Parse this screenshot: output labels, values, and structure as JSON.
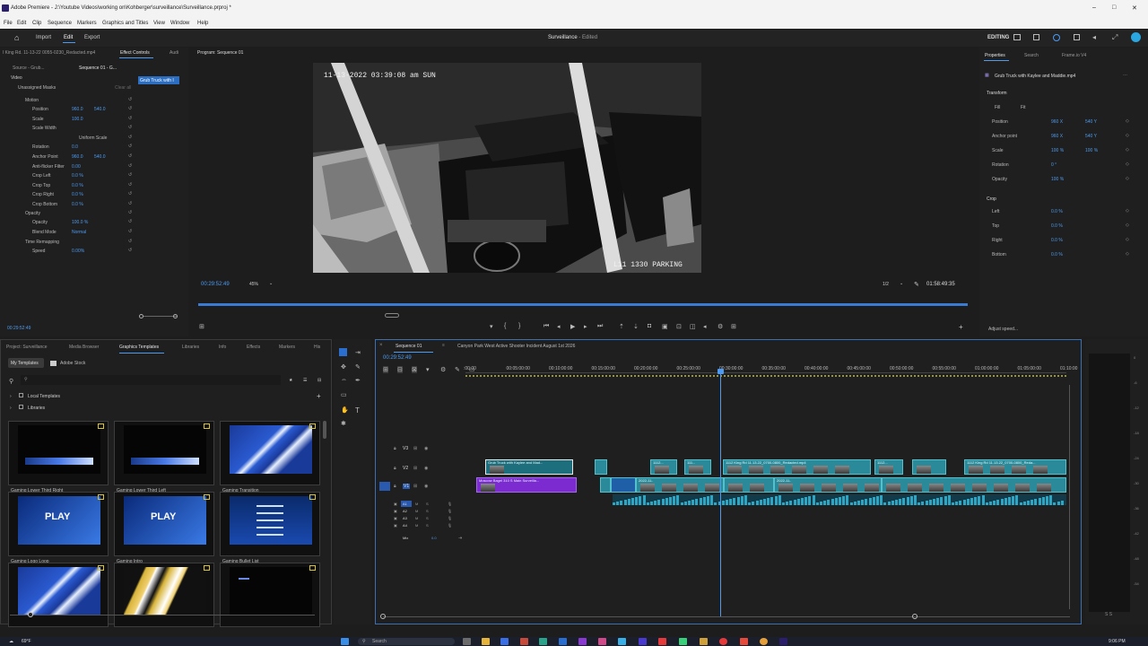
{
  "window": {
    "title": "Adobe Premiere - J:\\Youtube Videos\\working on\\Kohberger\\surveillance\\Surveillance.prproj *",
    "project_name": "Surveillance",
    "project_state": "- Edited",
    "mode_label": "EDITING"
  },
  "menu": [
    "File",
    "Edit",
    "Clip",
    "Sequence",
    "Markers",
    "Graphics and Titles",
    "View",
    "Window",
    "Help"
  ],
  "workspace_tabs": [
    "Import",
    "Edit",
    "Export"
  ],
  "effect_controls": {
    "tabs": [
      "Source - Grub...",
      "Sequence 01 - G..."
    ],
    "title_tab": "Effect Controls",
    "audio_tab": "Audi",
    "clip_chip": "Grub Truck with I",
    "left_clip_name": "l King Rd. 11-13-22 0055-0230_Redacted.mp4",
    "video_label": "Video",
    "masks_label": "Unassigned Masks",
    "clear_all": "Clear all",
    "rows": [
      {
        "label": "Motion",
        "value": "",
        "value2": ""
      },
      {
        "label": "Position",
        "value": "960.0",
        "value2": "540.0"
      },
      {
        "label": "Scale",
        "value": "100.0",
        "value2": ""
      },
      {
        "label": "Scale Width",
        "value": "",
        "value2": ""
      },
      {
        "label": "Uniform Scale",
        "value": "",
        "value2": ""
      },
      {
        "label": "Rotation",
        "value": "0.0",
        "value2": ""
      },
      {
        "label": "Anchor Point",
        "value": "960.0",
        "value2": "540.0"
      },
      {
        "label": "Anti-flicker Filter",
        "value": "0.00",
        "value2": ""
      },
      {
        "label": "Crop Left",
        "value": "0.0 %",
        "value2": ""
      },
      {
        "label": "Crop Top",
        "value": "0.0 %",
        "value2": ""
      },
      {
        "label": "Crop Right",
        "value": "0.0 %",
        "value2": ""
      },
      {
        "label": "Crop Bottom",
        "value": "0.0 %",
        "value2": ""
      },
      {
        "label": "Opacity",
        "value": "",
        "value2": ""
      },
      {
        "label": "Opacity",
        "value": "100.0 %",
        "value2": ""
      },
      {
        "label": "Blend Mode",
        "value": "Normal",
        "value2": ""
      },
      {
        "label": "Time Remapping",
        "value": "",
        "value2": ""
      },
      {
        "label": "Speed",
        "value": "0.00%",
        "value2": ""
      }
    ],
    "timecode": "00:29:52:49"
  },
  "program_monitor": {
    "title": "Program: Sequence 01",
    "timecode": "00:29:52:49",
    "zoom": "45%",
    "resolution": "1/2",
    "duration": "01:58:49:35",
    "overlay_timestamp": "11-13-2022 03:39:08 am SUN",
    "overlay_caption": "L11 1330 PARKING"
  },
  "properties": {
    "tabs": [
      "Properties",
      "Search",
      "Frame.io V4"
    ],
    "clip_name": "Grub Truck with Kaylee and Maddie.mp4",
    "transform_label": "Transform",
    "fill_label": "Fill",
    "fit_label": "Fit",
    "rows": [
      {
        "label": "Position",
        "v1": "960 X",
        "v2": "540 Y"
      },
      {
        "label": "Anchor point",
        "v1": "960 X",
        "v2": "540 Y"
      },
      {
        "label": "Scale",
        "v1": "100 %",
        "v2": "100 %"
      },
      {
        "label": "Rotation",
        "v1": "0 °",
        "v2": ""
      },
      {
        "label": "Opacity",
        "v1": "100 %",
        "v2": ""
      }
    ],
    "crop_label": "Crop",
    "crop_rows": [
      {
        "label": "Left",
        "v1": "0.0 %"
      },
      {
        "label": "Top",
        "v1": "0.0 %"
      },
      {
        "label": "Right",
        "v1": "0.0 %"
      },
      {
        "label": "Bottom",
        "v1": "0.0 %"
      }
    ],
    "adjust_speed": "Adjust speed..."
  },
  "project_panel": {
    "tabs": [
      "Project: Surveillance",
      "Media Browser",
      "Graphics Templates",
      "Libraries",
      "Info",
      "Effects",
      "Markers",
      "His"
    ],
    "subtabs": [
      "My Templates",
      "Adobe Stock"
    ],
    "search_placeholder": "",
    "tree": [
      "Local Templates",
      "Libraries"
    ],
    "templates": [
      {
        "name": "Gaming Lower Third Right"
      },
      {
        "name": "Gaming Lower Third Left"
      },
      {
        "name": "Gaming Transition"
      },
      {
        "name": "Gaming Logo Loop"
      },
      {
        "name": "Gaming Intro"
      },
      {
        "name": "Gaming Bullet List"
      },
      {
        "name": ""
      },
      {
        "name": ""
      },
      {
        "name": ""
      }
    ],
    "play_text": "PLAY"
  },
  "timeline": {
    "tabs": [
      "Sequence 01",
      "Canyon Park West Active Shooter Incident August 1st 2026"
    ],
    "timecode": "00:29:52:49",
    "ruler": [
      ":00:00",
      "00:05:00:00",
      "00:10:00:00",
      "00:15:00:00",
      "00:20:00:00",
      "00:25:00:00",
      "00:30:00:00",
      "00:35:00:00",
      "00:40:00:00",
      "00:45:00:00",
      "00:50:00:00",
      "00:55:00:00",
      "01:00:00:00",
      "01:05:00:00",
      "01:10:00"
    ],
    "tracks": [
      "V3",
      "V2",
      "V1",
      "A1",
      "A2",
      "A3",
      "A4",
      "Mix"
    ],
    "mix_value": "0.0",
    "clips": {
      "grub": "Grub Truck with Kaylee and Mad...",
      "moscow": "Moscow Bagel 310 S Main Surveilla...",
      "king1": "1112...",
      "king2": "111...",
      "king_main": "1112 King Rd 11.13.22_0700-0800_Redacted.mp4",
      "king3": "1112 King Rd 11.13.22_0700-0800_Reda...",
      "sub1": "2022-11-",
      "sub2": "2022-11-"
    }
  },
  "meters": {
    "labels": [
      "0",
      "-6",
      "-12",
      "-18",
      "-24",
      "-30",
      "-36",
      "-42",
      "-48",
      "-54"
    ],
    "bottom": "S S"
  },
  "taskbar": {
    "temp": "69°F",
    "search": "Search",
    "time": "9:06 PM"
  }
}
